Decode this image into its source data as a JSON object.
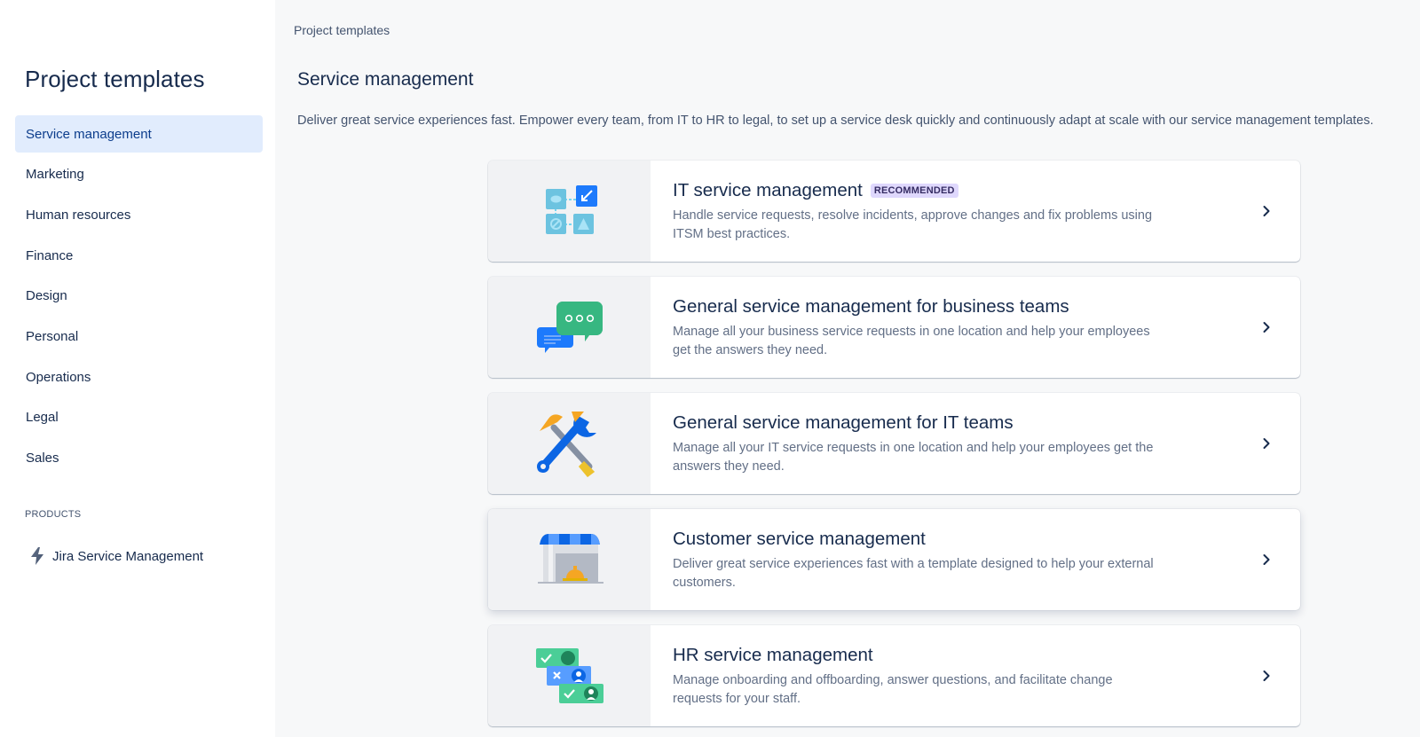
{
  "sidebar": {
    "title": "Project templates",
    "items": [
      {
        "label": "Service management"
      },
      {
        "label": "Marketing"
      },
      {
        "label": "Human resources"
      },
      {
        "label": "Finance"
      },
      {
        "label": "Design"
      },
      {
        "label": "Personal"
      },
      {
        "label": "Operations"
      },
      {
        "label": "Legal"
      },
      {
        "label": "Sales"
      }
    ],
    "active_item": "Service management",
    "products_label": "PRODUCTS",
    "product": {
      "label": "Jira Service Management",
      "icon": "lightning-bolt-icon"
    }
  },
  "main": {
    "breadcrumb": "Project templates",
    "heading": "Service management",
    "description": "Deliver great service experiences fast. Empower every team, from IT to HR to legal, to set up a service desk quickly and continuously adapt at scale with our service management templates.",
    "cards": [
      {
        "title": "IT service management",
        "badge": "RECOMMENDED",
        "description": "Handle service requests, resolve incidents, approve changes and fix problems using ITSM best practices.",
        "icon": "it-workflow-icon"
      },
      {
        "title": "General service management for business teams",
        "description": "Manage all your business service requests in one location and help your employees get the answers they need.",
        "icon": "chat-bubbles-icon"
      },
      {
        "title": "General service management for IT teams",
        "description": "Manage all your IT service requests in one location and help your employees get the answers they need.",
        "icon": "hammer-wrench-icon"
      },
      {
        "title": "Customer service management",
        "description": "Deliver great service experiences fast with a template designed to help your external customers.",
        "icon": "storefront-bell-icon"
      },
      {
        "title": "HR service management",
        "description": "Manage onboarding and offboarding, answer questions, and facilitate change requests for your staff.",
        "icon": "hr-people-icon"
      }
    ]
  },
  "colors": {
    "accent": "#0C66E4",
    "active_bg": "#E1ECFD",
    "badge_bg": "#DFD8FD",
    "page_bg": "#F7F8F9"
  }
}
